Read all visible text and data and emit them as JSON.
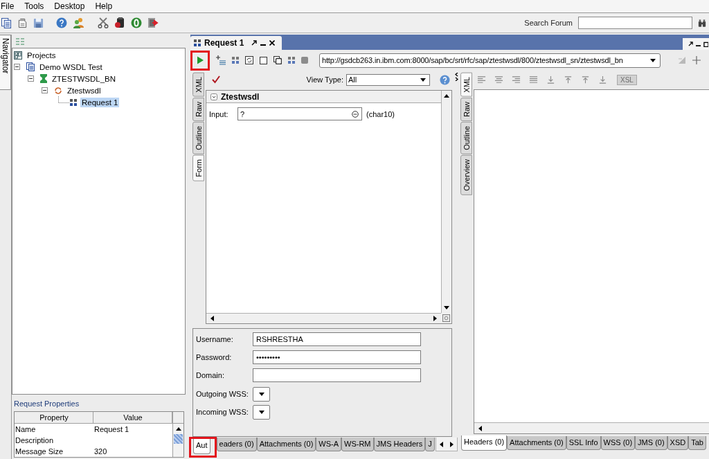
{
  "menu": [
    {
      "label": "File"
    },
    {
      "label": "Tools"
    },
    {
      "label": "Desktop"
    },
    {
      "label": "Help"
    }
  ],
  "search": {
    "label": "Search Forum"
  },
  "navigator": {
    "tab": "Navigator",
    "tree": [
      {
        "label": "Projects",
        "kind": "workspace",
        "selected": false,
        "children": [
          {
            "label": "Demo WSDL Test",
            "kind": "project",
            "selected": false,
            "expanded": true,
            "children": [
              {
                "label": "ZTESTWSDL_BN",
                "kind": "interface",
                "selected": false,
                "expanded": true,
                "children": [
                  {
                    "label": "Ztestwsdl",
                    "kind": "operation",
                    "selected": false,
                    "expanded": true,
                    "children": [
                      {
                        "label": "Request 1",
                        "kind": "request",
                        "selected": true
                      }
                    ]
                  }
                ]
              }
            ]
          }
        ]
      }
    ]
  },
  "properties": {
    "title": "Request Properties",
    "columns": [
      "Property",
      "Value"
    ],
    "rows": [
      {
        "property": "Name",
        "value": "Request 1"
      },
      {
        "property": "Description"
      },
      {
        "property": "Message Size",
        "value": "320"
      }
    ]
  },
  "editor": {
    "title": "Request 1",
    "run_button": {
      "highlighted": true
    },
    "url": "http://gsdcb263.in.ibm.com:8000/sap/bc/srt/rfc/sap/ztestwsdl/800/ztestwsdl_sn/ztestwsdl_bn",
    "request": {
      "side_tabs": [
        {
          "label": "XML",
          "selected": false
        },
        {
          "label": "Raw",
          "selected": false
        },
        {
          "label": "Outline",
          "selected": false
        },
        {
          "label": "Form",
          "selected": true
        }
      ],
      "view_type": {
        "label": "View Type:",
        "value": "All"
      },
      "form": {
        "title": "Ztestwsdl",
        "expanded": true,
        "fields": [
          {
            "label": "Input:",
            "value": "?",
            "type": "(char10)"
          }
        ]
      },
      "auth": {
        "fields": [
          {
            "label": "Username:",
            "kind": "text",
            "value": "RSHRESTHA"
          },
          {
            "label": "Password:",
            "kind": "text",
            "value": "•••••••••"
          },
          {
            "label": "Domain:",
            "kind": "text"
          },
          {
            "label": "Outgoing WSS:",
            "kind": "dropdown"
          },
          {
            "label": "Incoming WSS:",
            "kind": "dropdown"
          }
        ]
      },
      "tabs": [
        {
          "label": "Aut",
          "selected": true,
          "highlighted": true
        },
        {
          "label": "eaders (0)",
          "selected": false,
          "highlighted": false
        },
        {
          "label": "Attachments (0)",
          "selected": false,
          "highlighted": false
        },
        {
          "label": "WS-A",
          "selected": false,
          "highlighted": false
        },
        {
          "label": "WS-RM",
          "selected": false,
          "highlighted": false
        },
        {
          "label": "JMS Headers",
          "selected": false,
          "highlighted": false
        },
        {
          "label": "J",
          "selected": false,
          "highlighted": false
        }
      ]
    },
    "response": {
      "side_tabs": [
        {
          "label": "XML",
          "selected": true
        },
        {
          "label": "Raw",
          "selected": false
        },
        {
          "label": "Outline",
          "selected": false
        },
        {
          "label": "Overview",
          "selected": false
        }
      ],
      "xsl_button": {
        "label": "XSL",
        "disabled": true
      },
      "tabs": [
        {
          "label": "Headers (0)",
          "selected": true
        },
        {
          "label": "Attachments (0)",
          "selected": false
        },
        {
          "label": "SSL Info",
          "selected": false
        },
        {
          "label": "WSS (0)",
          "selected": false
        },
        {
          "label": "JMS (0)",
          "selected": false
        },
        {
          "label": "XSD",
          "selected": false
        },
        {
          "label": "Tab",
          "selected": false
        }
      ]
    }
  }
}
